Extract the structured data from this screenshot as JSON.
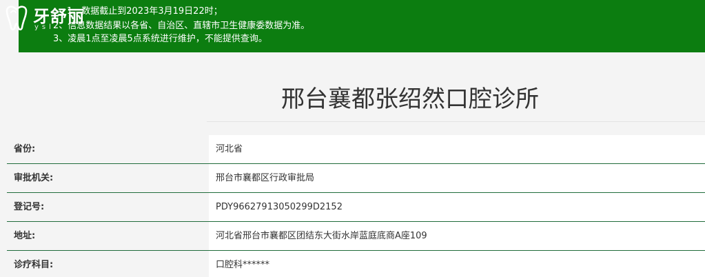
{
  "logo": {
    "text": "牙舒丽",
    "subtext": "ysl"
  },
  "notice": {
    "lines": [
      "1、数据截止到2023年3月19日22时；",
      "2、信息数据结果以各省、自治区、直辖市卫生健康委数据为准。",
      "3、凌晨1点至凌晨5点系统进行维护，不能提供查询。"
    ],
    "background_color": "#0c7d10"
  },
  "title": "邢台襄都张绍然口腔诊所",
  "details": [
    {
      "label": "省份:",
      "value": "河北省"
    },
    {
      "label": "审批机关:",
      "value": "邢台市襄都区行政审批局"
    },
    {
      "label": "登记号:",
      "value": "PDY96627913050299D2152"
    },
    {
      "label": "地址:",
      "value": "河北省邢台市襄都区团结东大街水岸蓝庭底商A座109"
    },
    {
      "label": "诊疗科目:",
      "value": "口腔科******"
    }
  ],
  "colors": {
    "row_divider": "#1f6b3a",
    "text": "#333333"
  }
}
